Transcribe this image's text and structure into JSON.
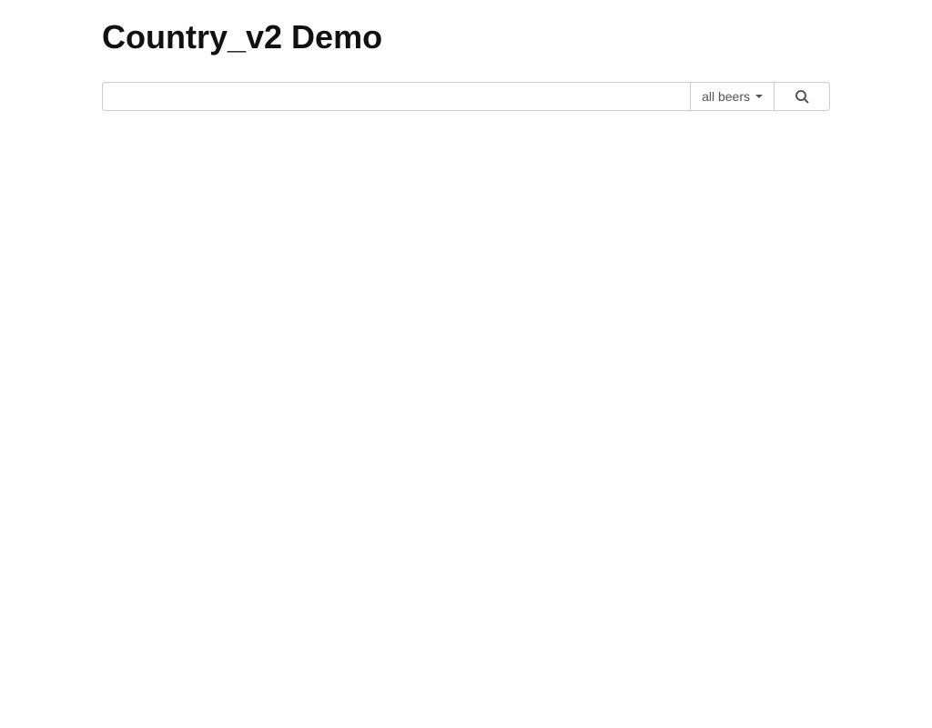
{
  "header": {
    "title": "Country_v2 Demo"
  },
  "search": {
    "input_value": "",
    "filter_label": "all beers"
  }
}
